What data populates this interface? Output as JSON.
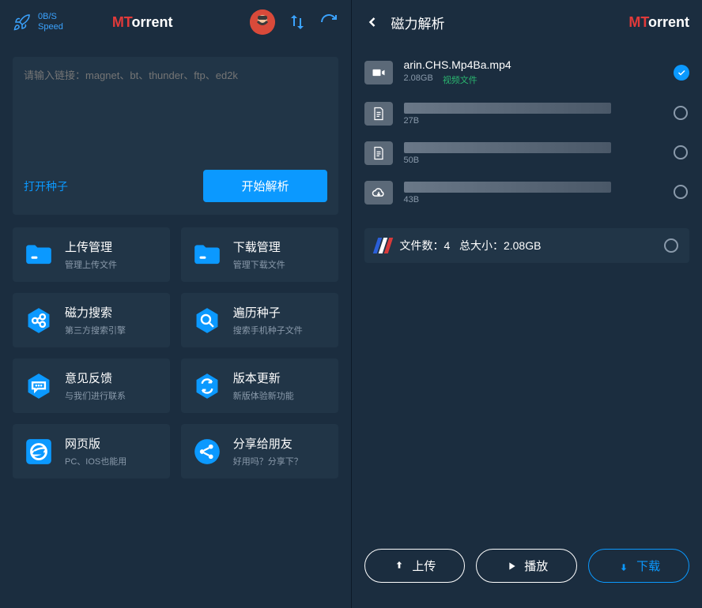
{
  "left": {
    "speed": {
      "value": "0B/S",
      "label": "Speed"
    },
    "brand": {
      "m": "MT",
      "rest": "orrent"
    },
    "input_placeholder": "请输入链接：magnet、bt、thunder、ftp、ed2k",
    "open_seed": "打开种子",
    "parse_btn": "开始解析",
    "tiles": [
      {
        "title": "上传管理",
        "sub": "管理上传文件",
        "icon": "folder"
      },
      {
        "title": "下载管理",
        "sub": "管理下载文件",
        "icon": "folder"
      },
      {
        "title": "磁力搜索",
        "sub": "第三方搜索引擎",
        "icon": "hex-link"
      },
      {
        "title": "遍历种子",
        "sub": "搜索手机种子文件",
        "icon": "hex-search"
      },
      {
        "title": "意见反馈",
        "sub": "与我们进行联系",
        "icon": "hex-chat"
      },
      {
        "title": "版本更新",
        "sub": "新版体验新功能",
        "icon": "hex-sync"
      },
      {
        "title": "网页版",
        "sub": "PC、IOS也能用",
        "icon": "ie"
      },
      {
        "title": "分享给朋友",
        "sub": "好用吗？分享下？",
        "icon": "share"
      }
    ]
  },
  "right": {
    "title": "磁力解析",
    "brand": {
      "m": "MT",
      "rest": "orrent"
    },
    "files": [
      {
        "name": "arin.CHS.Mp4Ba.mp4",
        "size": "2.08GB",
        "tag": "视频文件",
        "icon": "video",
        "checked": true,
        "showName": true
      },
      {
        "name": "",
        "size": "27B",
        "tag": "",
        "icon": "text",
        "checked": false,
        "showName": false
      },
      {
        "name": "",
        "size": "50B",
        "tag": "",
        "icon": "text",
        "checked": false,
        "showName": false
      },
      {
        "name": "",
        "size": "43B",
        "tag": "",
        "icon": "cloud",
        "checked": false,
        "showName": false
      }
    ],
    "summary": {
      "files_label": "文件数：",
      "files_count": "4",
      "size_label": "总大小：",
      "size_value": "2.08GB"
    },
    "actions": {
      "upload": "上传",
      "play": "播放",
      "download": "下载"
    }
  }
}
